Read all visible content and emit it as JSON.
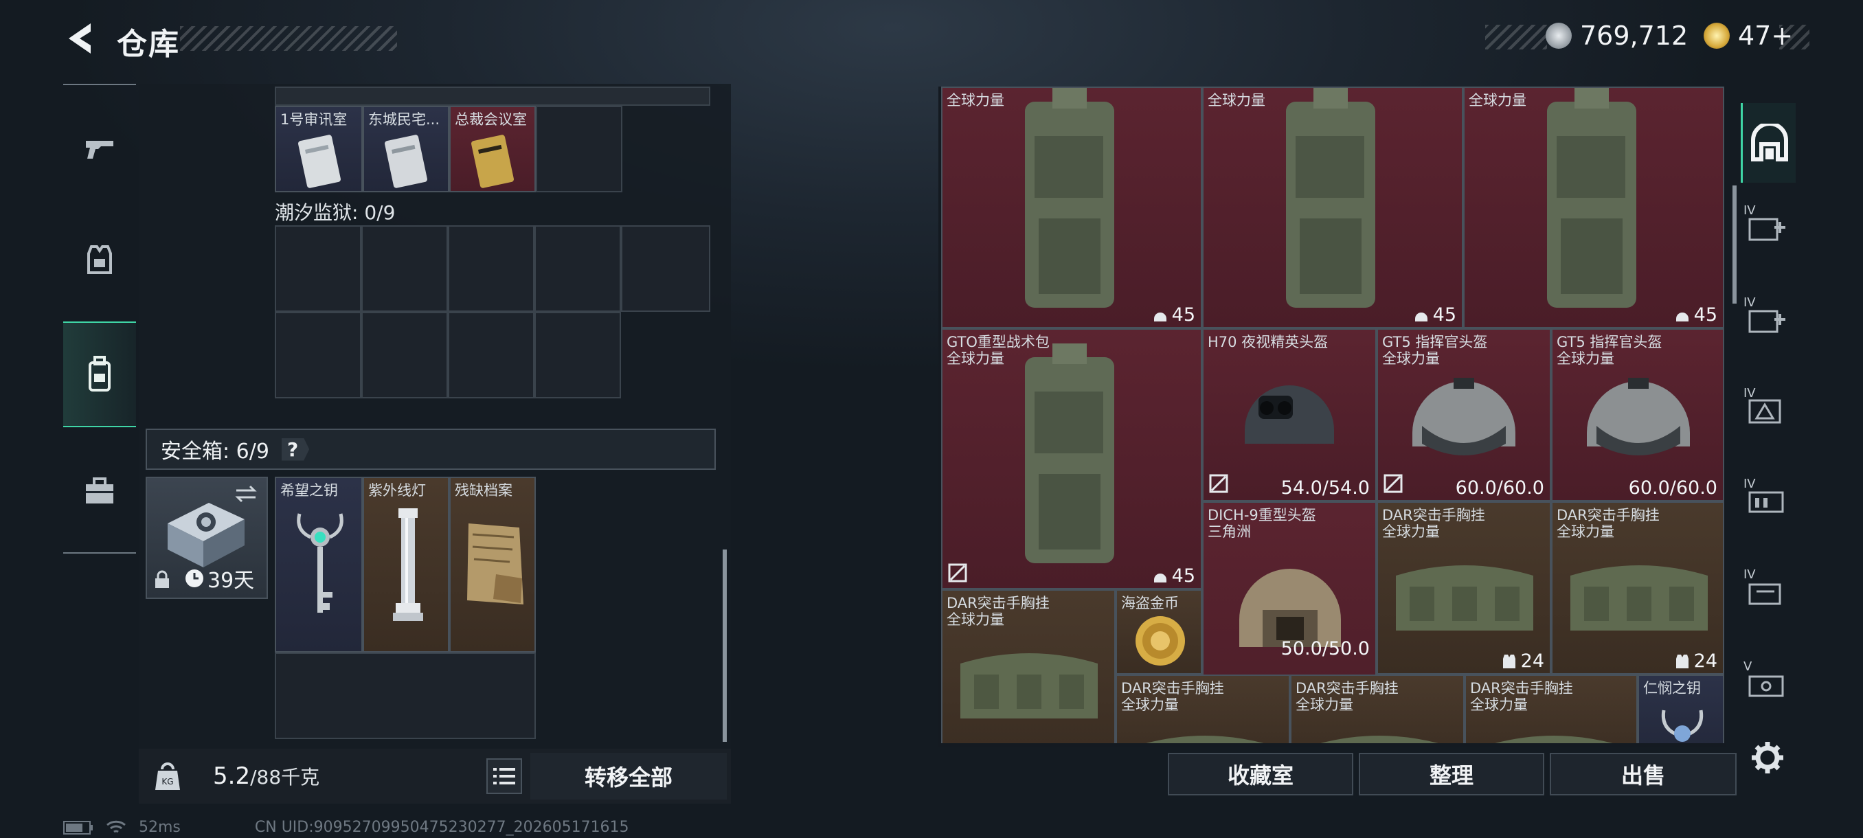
{
  "header": {
    "title": "仓库"
  },
  "currency": {
    "silver": "769,712",
    "gold": "47+"
  },
  "left_nav": {
    "items": [
      {
        "name": "weapons",
        "icon": "gun-icon"
      },
      {
        "name": "equipment",
        "icon": "armor-vest-icon"
      },
      {
        "name": "backpack",
        "icon": "backpack-icon"
      },
      {
        "name": "supplies",
        "icon": "toolbox-icon"
      }
    ]
  },
  "keys_top": {
    "labels": [
      "1号审讯室",
      "东城民宅...",
      "总裁会议室"
    ]
  },
  "prison": {
    "label": "潮汐监狱: 0/9"
  },
  "safebox": {
    "label": "安全箱: 6/9",
    "help": "?",
    "timer": "39天",
    "items": [
      {
        "label": "希望之钥",
        "color": "navy"
      },
      {
        "label": "紫外线灯",
        "color": "brown"
      },
      {
        "label": "残缺档案",
        "color": "brown"
      }
    ]
  },
  "footer": {
    "weight": "5.2",
    "weight_max": "/88千克",
    "transfer_all": "转移全部"
  },
  "stash_items": [
    {
      "name": "",
      "sub": "全球力量",
      "count": "45",
      "count_icon": "helmet-count-icon",
      "color": "red"
    },
    {
      "name": "",
      "sub": "全球力量",
      "count": "45",
      "count_icon": "helmet-count-icon",
      "color": "red"
    },
    {
      "name": "",
      "sub": "全球力量",
      "count": "45",
      "count_icon": "helmet-count-icon",
      "color": "red"
    },
    {
      "name": "GTO重型战术包",
      "sub": "全球力量",
      "count": "45",
      "count_icon": "durability-icon",
      "color": "red"
    },
    {
      "name": "H70 夜视精英头盔",
      "sub": "",
      "count": "54.0/54.0",
      "count_icon": "durability-icon",
      "color": "red"
    },
    {
      "name": "GT5 指挥官头盔",
      "sub": "全球力量",
      "count": "60.0/60.0",
      "count_icon": "durability-icon",
      "color": "red"
    },
    {
      "name": "GT5 指挥官头盔",
      "sub": "全球力量",
      "count": "60.0/60.0",
      "count_icon": "",
      "color": "red"
    },
    {
      "name": "DICH-9重型头盔",
      "sub": "三角洲",
      "count": "50.0/50.0",
      "count_icon": "",
      "color": "red"
    },
    {
      "name": "DAR突击手胸挂",
      "sub": "全球力量",
      "count": "24",
      "count_icon": "vest-count-icon",
      "color": "brown"
    },
    {
      "name": "DAR突击手胸挂",
      "sub": "全球力量",
      "count": "24",
      "count_icon": "vest-count-icon",
      "color": "brown"
    },
    {
      "name": "DAR突击手胸挂",
      "sub": "全球力量",
      "count": "",
      "count_icon": "",
      "color": "brown"
    },
    {
      "name": "海盗金币",
      "sub": "",
      "count": "",
      "count_icon": "",
      "color": "brown"
    },
    {
      "name": "DAR突击手胸挂",
      "sub": "全球力量",
      "count": "",
      "count_icon": "",
      "color": "brown"
    },
    {
      "name": "DAR突击手胸挂",
      "sub": "全球力量",
      "count": "",
      "count_icon": "",
      "color": "brown"
    },
    {
      "name": "DAR突击手胸挂",
      "sub": "全球力量",
      "count": "",
      "count_icon": "",
      "color": "brown"
    },
    {
      "name": "仁悯之钥",
      "sub": "",
      "count": "",
      "count_icon": "",
      "color": "navy"
    }
  ],
  "bottom_buttons": {
    "collection": "收藏室",
    "organize": "整理",
    "sell": "出售"
  },
  "right_tabs": {
    "items": [
      "IV",
      "IV",
      "IV",
      "IV",
      "IV",
      "V"
    ]
  },
  "status_bar": {
    "ping": "52ms",
    "uid": "CN UID:909527099504752302​77_202605171615"
  },
  "colors": {
    "accent": "#3fd6a6",
    "red_item": "#5b2430",
    "brown_item": "#4a3a2c",
    "navy_item": "#2c3248"
  }
}
